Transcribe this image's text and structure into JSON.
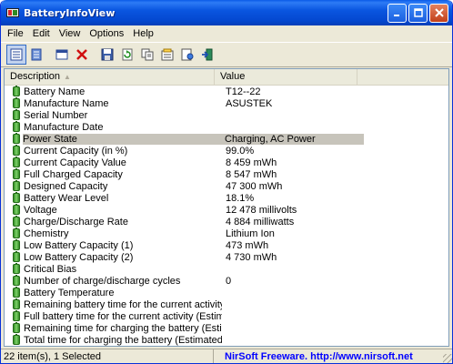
{
  "window": {
    "title": "BatteryInfoView"
  },
  "menu": [
    "File",
    "Edit",
    "View",
    "Options",
    "Help"
  ],
  "table": {
    "columns": [
      "Description",
      "Value"
    ],
    "rows": [
      {
        "d": "Battery Name",
        "v": "T12--22"
      },
      {
        "d": "Manufacture Name",
        "v": "ASUSTEK"
      },
      {
        "d": "Serial Number",
        "v": ""
      },
      {
        "d": "Manufacture Date",
        "v": ""
      },
      {
        "d": "Power State",
        "v": "Charging, AC Power",
        "selected": true
      },
      {
        "d": "Current Capacity (in %)",
        "v": "99.0%"
      },
      {
        "d": "Current Capacity Value",
        "v": "8 459 mWh"
      },
      {
        "d": "Full Charged Capacity",
        "v": "8 547 mWh"
      },
      {
        "d": "Designed Capacity",
        "v": "47 300 mWh"
      },
      {
        "d": "Battery Wear Level",
        "v": "18.1%"
      },
      {
        "d": "Voltage",
        "v": "12 478 millivolts"
      },
      {
        "d": "Charge/Discharge Rate",
        "v": "4 884 milliwatts"
      },
      {
        "d": "Chemistry",
        "v": "Lithium Ion"
      },
      {
        "d": "Low Battery Capacity (1)",
        "v": "473 mWh"
      },
      {
        "d": "Low Battery Capacity (2)",
        "v": "4 730 mWh"
      },
      {
        "d": "Critical Bias",
        "v": ""
      },
      {
        "d": "Number of charge/discharge cycles",
        "v": "0"
      },
      {
        "d": "Battery Temperature",
        "v": ""
      },
      {
        "d": "Remaining battery time for the current activity (Estima...",
        "v": ""
      },
      {
        "d": "Full battery time for the current activity (Estimated)",
        "v": ""
      },
      {
        "d": "Remaining time for charging the battery (Estimated)",
        "v": ""
      },
      {
        "d": "Total  time for charging the battery (Estimated)",
        "v": ""
      }
    ]
  },
  "status": {
    "count": "22 item(s), 1 Selected",
    "credit": "NirSoft Freeware.  http://www.nirsoft.net"
  },
  "colors": {
    "accent": "#0a56e0",
    "link": "#0000ff",
    "battery": "#2f8a22"
  }
}
